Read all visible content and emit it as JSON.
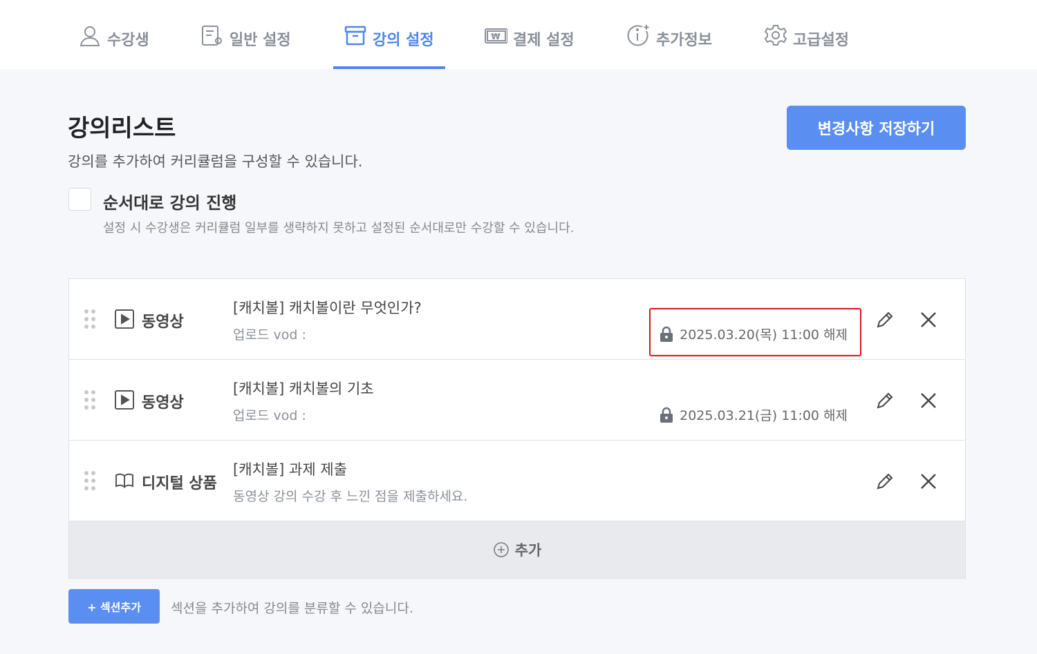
{
  "tabs": [
    {
      "label": "수강생",
      "icon": "user-icon",
      "active": false
    },
    {
      "label": "일반 설정",
      "icon": "document-settings-icon",
      "active": false
    },
    {
      "label": "강의 설정",
      "icon": "archive-box-icon",
      "active": true
    },
    {
      "label": "결제 설정",
      "icon": "won-bill-icon",
      "active": false
    },
    {
      "label": "추가정보",
      "icon": "info-plus-icon",
      "active": false
    },
    {
      "label": "고급설정",
      "icon": "gear-icon",
      "active": false
    }
  ],
  "page": {
    "title": "강의리스트",
    "description": "강의를 추가하여 커리큘럼을 구성할 수 있습니다.",
    "save_label": "변경사항 저장하기"
  },
  "sequential": {
    "label": "순서대로 강의 진행",
    "description": "설정 시 수강생은 커리큘럼 일부를 생략하지 못하고 설정된 순서대로만 수강할 수 있습니다.",
    "checked": false
  },
  "lectures": [
    {
      "type_label": "동영상",
      "type_icon": "play-video-icon",
      "title": "[캐치볼] 캐치볼이란 무엇인가?",
      "subtitle": "업로드  vod :",
      "unlock": "2025.03.20(목) 11:00 해제",
      "highlighted": true
    },
    {
      "type_label": "동영상",
      "type_icon": "play-video-icon",
      "title": "[캐치볼] 캐치볼의 기초",
      "subtitle": "업로드  vod :",
      "unlock": "2025.03.21(금) 11:00 해제",
      "highlighted": false
    },
    {
      "type_label": "디지털 상품",
      "type_icon": "open-book-icon",
      "title": "[캐치볼] 과제 제출",
      "subtitle": "동영상 강의 수강 후 느낀 점을 제출하세요.",
      "unlock": "",
      "highlighted": false
    }
  ],
  "add_label": "추가",
  "section": {
    "button_label": "+ 섹션추가",
    "description": "섹션을 추가하여 강의를 분류할 수 있습니다."
  },
  "colors": {
    "accent": "#4f86ee",
    "button": "#5b8ef1",
    "highlight": "#e0101a"
  }
}
